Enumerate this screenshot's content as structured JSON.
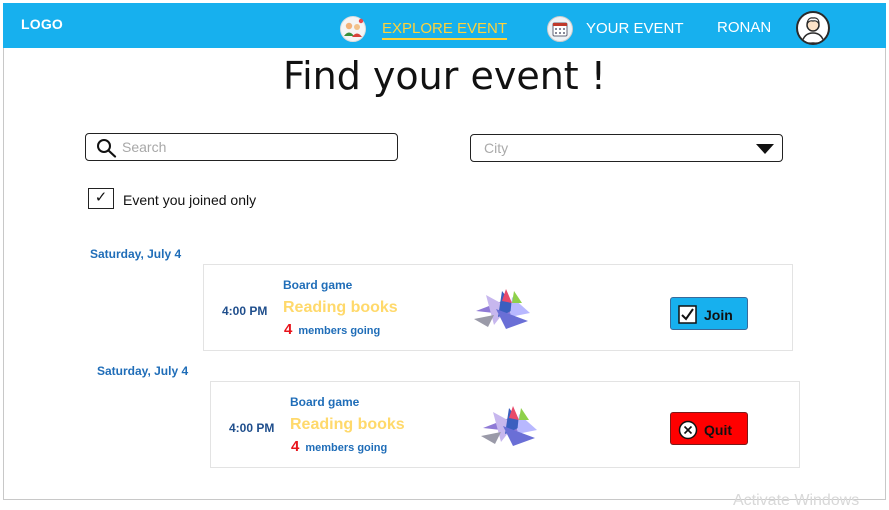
{
  "header": {
    "logo": "LOGO",
    "nav": {
      "explore_label": "EXPLORE EVENT",
      "your_event_label": "YOUR EVENT",
      "user_name": "RONAN"
    }
  },
  "main": {
    "title": "Find your event !",
    "search": {
      "placeholder": "Search",
      "value": ""
    },
    "city": {
      "placeholder": "City",
      "selected": "City"
    },
    "filter": {
      "checked": true,
      "check_mark": "✓",
      "label": "Event you joined only"
    },
    "events": [
      {
        "date": "Saturday, July 4",
        "time": "4:00 PM",
        "category": "Board game",
        "title": "Reading books",
        "members_count": "4",
        "members_text": "members going",
        "action_label": "Join",
        "action_icon": "checkbox-checked-icon"
      },
      {
        "date": "Saturday, July 4",
        "time": "4:00 PM",
        "category": "Board game",
        "title": "Reading books",
        "members_count": "4",
        "members_text": "members going",
        "action_label": "Quit",
        "action_icon": "circle-x-icon"
      }
    ]
  },
  "system": {
    "watermark": "Activate Windows"
  },
  "colors": {
    "topbar": "#17b0ee",
    "active_nav": "#ffd23a",
    "date_text": "#1f6db8",
    "title_text": "#ffd96b",
    "count_text": "#e8141c",
    "join_button": "#17b0ee",
    "quit_button": "#ff0000"
  }
}
